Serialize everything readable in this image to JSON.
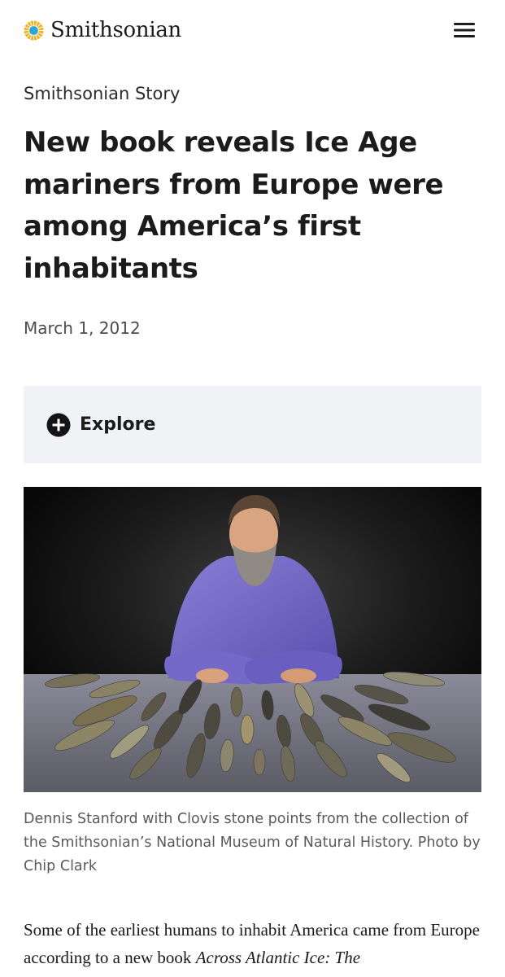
{
  "header": {
    "logo_text": "Smithsonian",
    "logo_icon": "smithsonian-sun-logo",
    "menu_icon": "hamburger-menu-icon"
  },
  "article": {
    "kicker": "Smithsonian Story",
    "title": "New book reveals Ice Age mariners from Europe were among America’s first inhabitants",
    "date": "March 1, 2012",
    "explore_label": "Explore",
    "explore_icon": "plus-circle-icon",
    "image_caption": "Dennis Stanford with Clovis stone points from the collection of the Smithsonian’s National Museum of Natural History. Photo by Chip Clark",
    "body_intro": "Some of the earliest humans to inhabit America came from Europe according to a new book ",
    "body_book_title": "Across Atlantic Ice: The"
  },
  "colors": {
    "logo_sun": "#f4b400",
    "logo_disc": "#2aa7d6",
    "explore_bg": "#f1f2f5",
    "text_primary": "#1b1b1b",
    "text_muted": "#5a5a5a"
  }
}
